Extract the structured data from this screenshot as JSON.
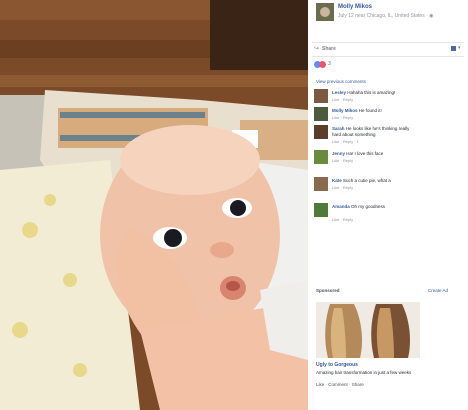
{
  "post": {
    "author": "Molly Mikos",
    "meta": "July 12 near Chicago, IL, United States · ",
    "share_label": "Share",
    "reactions_count": "3",
    "previous_comments": "View previous comments"
  },
  "comments": [
    {
      "name": "Lesley",
      "text": "Hahaha this is amazing!",
      "text2": "",
      "actions": "Like · Reply"
    },
    {
      "name": "Molly Mikos",
      "text": "He found it! ",
      "text2": "",
      "actions": "Like · Reply"
    },
    {
      "name": "Sarah",
      "text": "He looks like he's thinking really",
      "text2": "hard about something",
      "actions": "Like · Reply · 1"
    },
    {
      "name": "Jenny",
      "text": "Ha! I love this face",
      "text2": "",
      "actions": "Like · Reply"
    },
    {
      "name": "Kate",
      "text": "Such a cutie pie, what a",
      "text2": "",
      "actions": "Like · Reply"
    },
    {
      "name": "Amanda",
      "text": "Oh my goodness",
      "text2": "",
      "actions": "Like · Reply"
    }
  ],
  "ad": {
    "label": "Sponsored",
    "create": "Create Ad",
    "title": "Ugly to Gorgeous",
    "text": "Amazing hair transformation in just a few weeks",
    "foot": "Like · Comment · Share"
  },
  "colors": {
    "link": "#365899",
    "like": "#5890ff",
    "love": "#f25268"
  }
}
